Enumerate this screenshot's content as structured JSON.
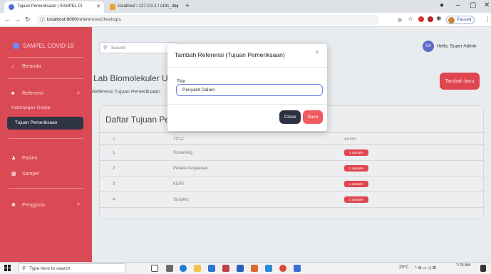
{
  "browser": {
    "tabs": [
      {
        "title": "Tujuan Pemeriksaan | SAMPEL Cl",
        "active": true
      },
      {
        "title": "localhost / 127.0.0.1 / c19s_db | ",
        "active": false
      }
    ],
    "address": {
      "host": "localhost:8000",
      "path": "/references/checkups"
    },
    "profile_label": "Paused"
  },
  "sidebar": {
    "brand": "SAMPEL COVID-19",
    "items": [
      {
        "label": "Beranda",
        "icon": "home-icon"
      },
      {
        "label": "Referensi",
        "icon": "book-icon",
        "chevron": ">"
      },
      {
        "label": "Pasien",
        "icon": "user-icon"
      },
      {
        "label": "Sampel",
        "icon": "grid-icon"
      },
      {
        "label": "Pengguna",
        "icon": "users-icon",
        "chevron": ">"
      }
    ],
    "subitems": [
      {
        "label": "Keterangan Gejala",
        "active": false
      },
      {
        "label": "Tujuan Pemeriksaan",
        "active": true
      }
    ]
  },
  "topnav": {
    "search_placeholder": "Search",
    "user_initials": "SA",
    "user_name": "Hello, Super Admin"
  },
  "page": {
    "title": "Lab Biomolekuler Universitas Hasanuddin",
    "subtitle": "Referensi Tujuan Pemeriksaan",
    "add_button": "Tambah baru"
  },
  "table": {
    "title": "Daftar Tujuan Pemeriksaan",
    "columns": [
      "#",
      "TITLE",
      "AKSIN"
    ],
    "rows": [
      {
        "no": "1",
        "title": "Screening",
        "badge": "3 Sampler"
      },
      {
        "no": "2",
        "title": "Pelaku Perjalanan",
        "badge": "1 Sampler"
      },
      {
        "no": "3",
        "title": "KERT",
        "badge": "1 Sampler"
      },
      {
        "no": "4",
        "title": "Suspect",
        "badge": "1 Sampler"
      }
    ]
  },
  "modal": {
    "title": "Tambah Referensi (Tujuan Pemeriksaan)",
    "field_label": "Title",
    "field_value": "Penyakit Dalam",
    "close_label": "Close",
    "save_label": "Save"
  },
  "taskbar": {
    "search_placeholder": "Type here to search",
    "weather": "29°C",
    "time": "7:25 AM"
  },
  "colors": {
    "sidebar": "#d94a55",
    "accent": "#e0464f",
    "dark": "#2d3142"
  }
}
